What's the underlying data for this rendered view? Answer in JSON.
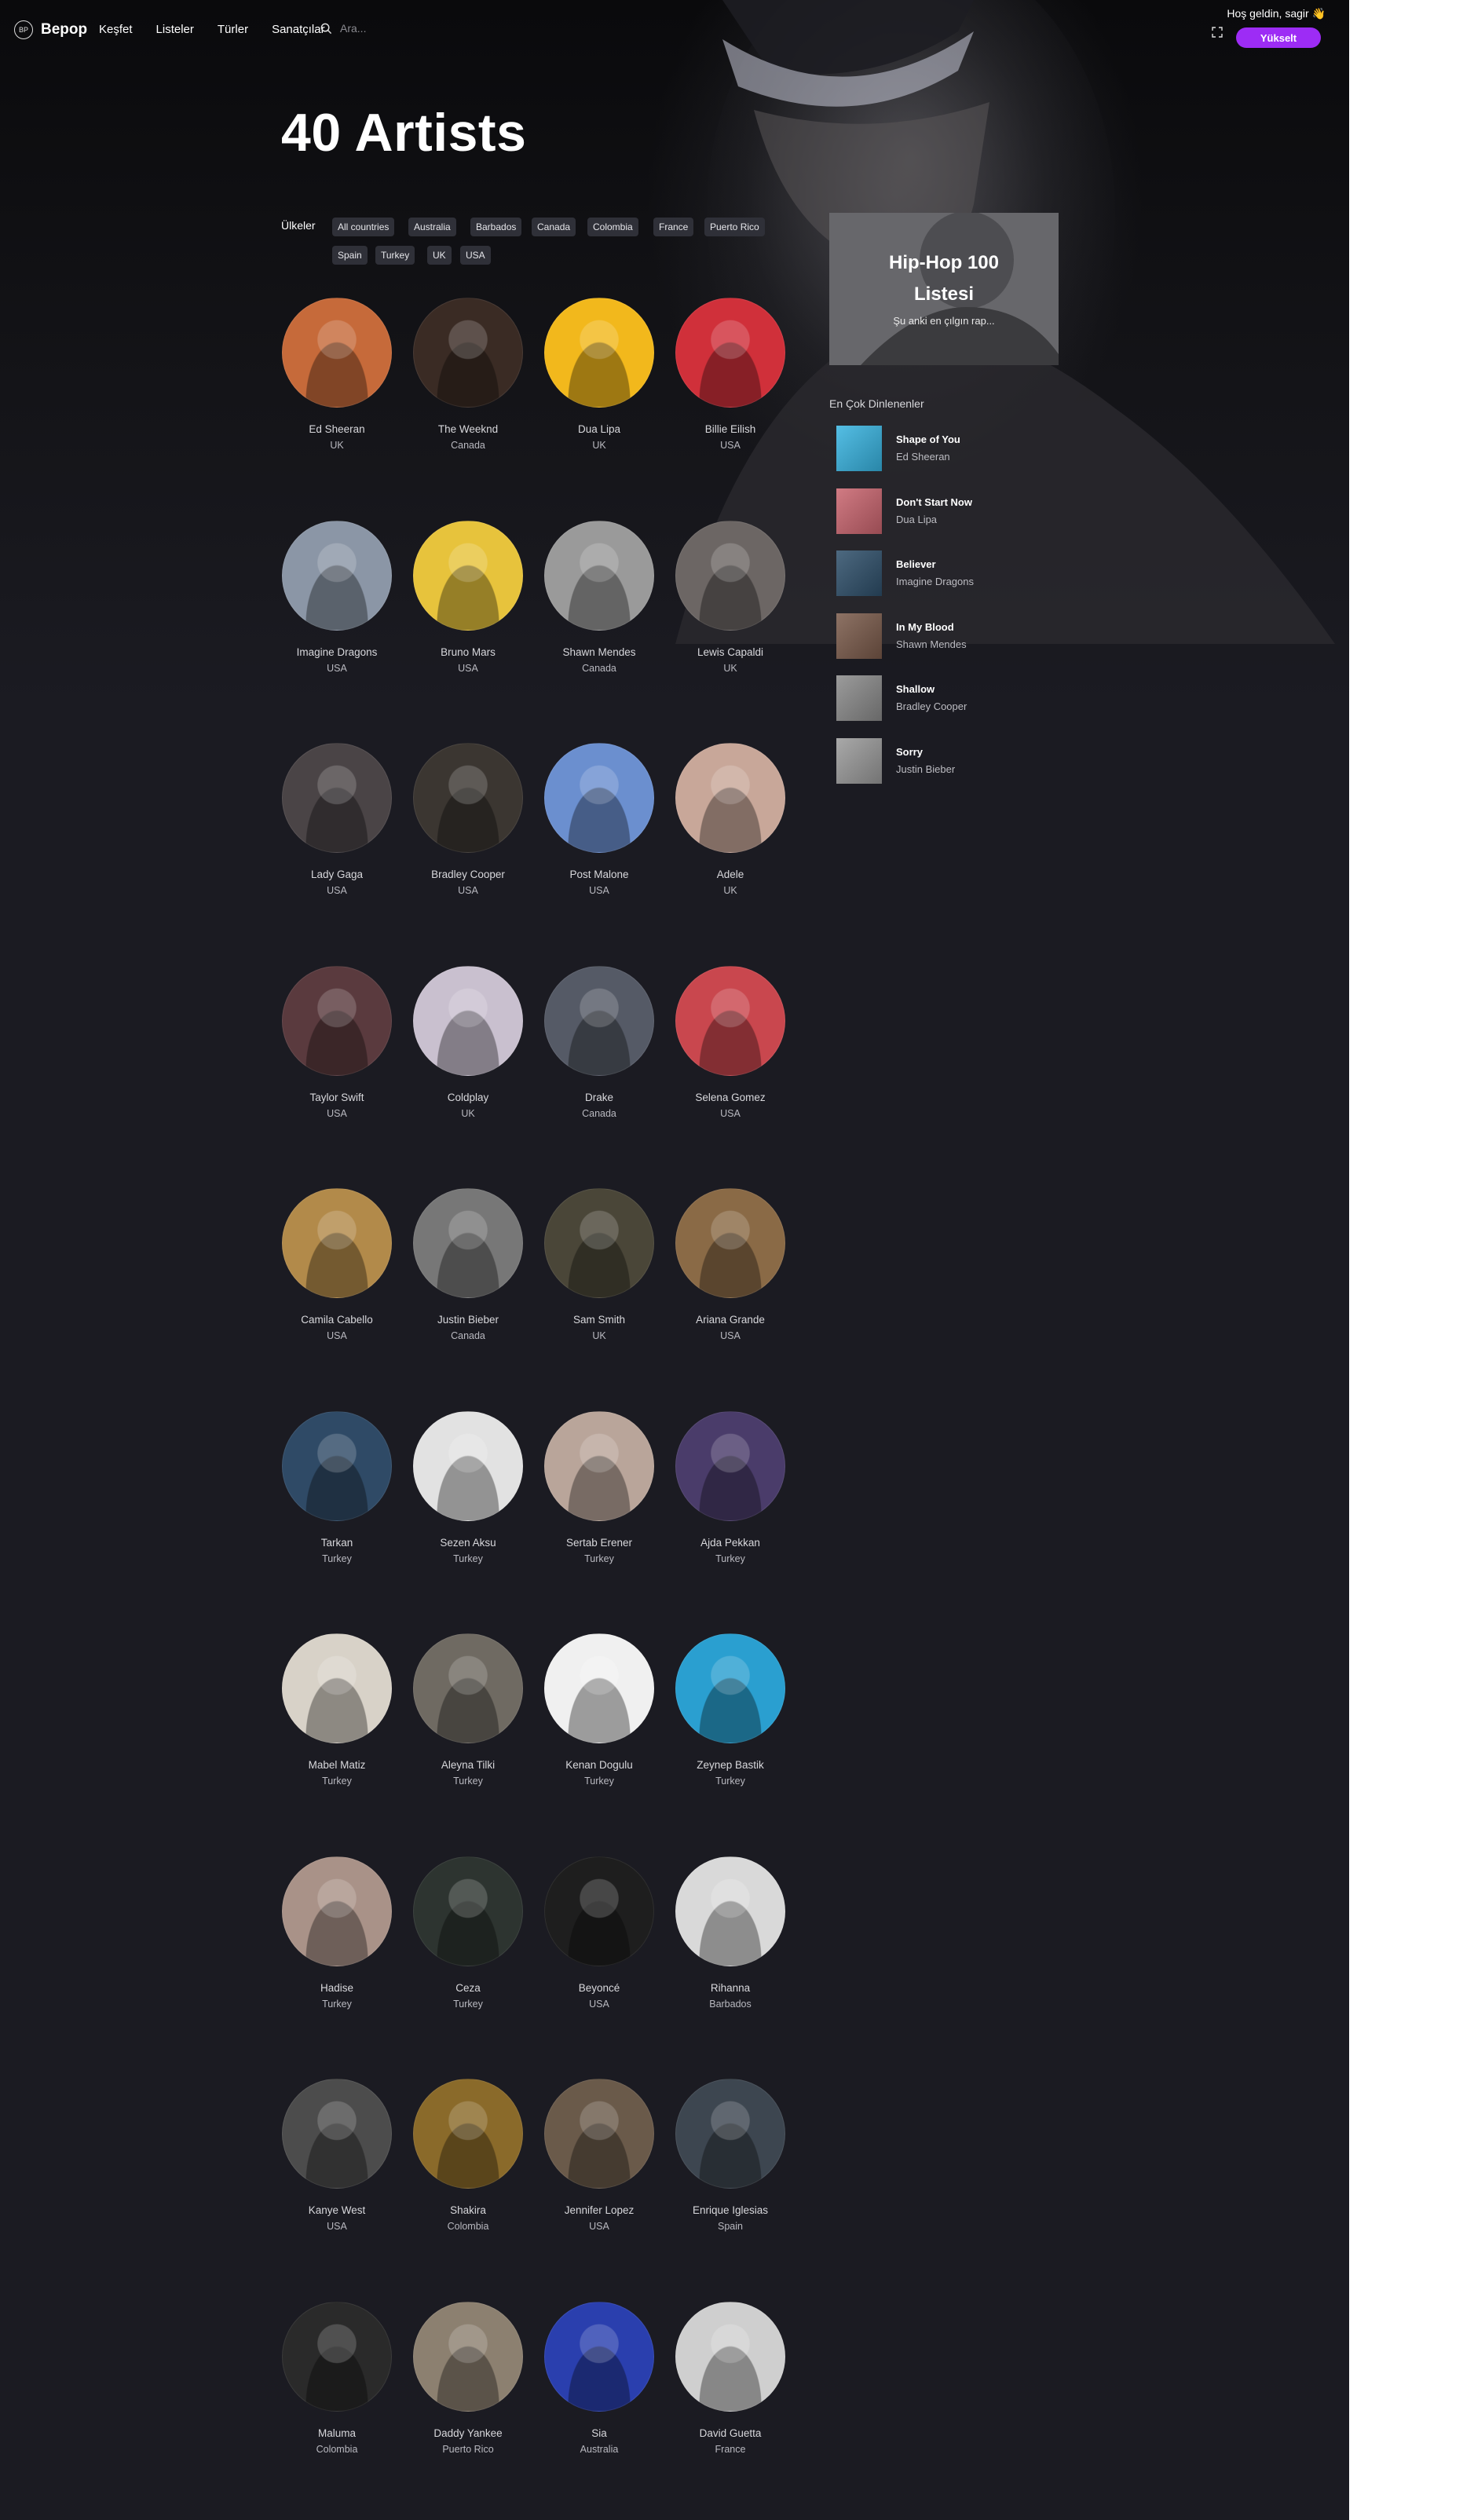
{
  "brand": {
    "logo_mark": "BP",
    "name": "Bepop"
  },
  "nav": {
    "links": [
      "Keşfet",
      "Listeler",
      "Türler",
      "Sanatçılar"
    ]
  },
  "search": {
    "placeholder": "Ara..."
  },
  "user": {
    "welcome": "Hoş geldin, sagir 👋",
    "upgrade_label": "Yükselt"
  },
  "page": {
    "title": "40 Artists"
  },
  "filters": {
    "label": "Ülkeler",
    "countries": [
      "All countries",
      "Australia",
      "Barbados",
      "Canada",
      "Colombia",
      "France",
      "Puerto Rico",
      "Spain",
      "Turkey",
      "UK",
      "USA"
    ]
  },
  "artists": [
    {
      "name": "Ed Sheeran",
      "country": "UK",
      "color": "#c66a3a"
    },
    {
      "name": "The Weeknd",
      "country": "Canada",
      "color": "#3a2b24"
    },
    {
      "name": "Dua Lipa",
      "country": "UK",
      "color": "#f2b81c"
    },
    {
      "name": "Billie Eilish",
      "country": "USA",
      "color": "#d0303a"
    },
    {
      "name": "Imagine Dragons",
      "country": "USA",
      "color": "#8b96a6"
    },
    {
      "name": "Bruno Mars",
      "country": "USA",
      "color": "#e7c33c"
    },
    {
      "name": "Shawn Mendes",
      "country": "Canada",
      "color": "#9a9a9a"
    },
    {
      "name": "Lewis Capaldi",
      "country": "UK",
      "color": "#6c6664"
    },
    {
      "name": "Lady Gaga",
      "country": "USA",
      "color": "#4a4446"
    },
    {
      "name": "Bradley Cooper",
      "country": "USA",
      "color": "#3b3631"
    },
    {
      "name": "Post Malone",
      "country": "USA",
      "color": "#6b8fcf"
    },
    {
      "name": "Adele",
      "country": "UK",
      "color": "#c8a799"
    },
    {
      "name": "Taylor Swift",
      "country": "USA",
      "color": "#5a3a3e"
    },
    {
      "name": "Coldplay",
      "country": "UK",
      "color": "#c9c0cf"
    },
    {
      "name": "Drake",
      "country": "Canada",
      "color": "#555a66"
    },
    {
      "name": "Selena Gomez",
      "country": "USA",
      "color": "#c9474e"
    },
    {
      "name": "Camila Cabello",
      "country": "USA",
      "color": "#b28a4a"
    },
    {
      "name": "Justin Bieber",
      "country": "Canada",
      "color": "#777"
    },
    {
      "name": "Sam Smith",
      "country": "UK",
      "color": "#4a4638"
    },
    {
      "name": "Ariana Grande",
      "country": "USA",
      "color": "#8a6a46"
    },
    {
      "name": "Tarkan",
      "country": "Turkey",
      "color": "#2f4a66"
    },
    {
      "name": "Sezen Aksu",
      "country": "Turkey",
      "color": "#e2e2e2"
    },
    {
      "name": "Sertab Erener",
      "country": "Turkey",
      "color": "#b9a59a"
    },
    {
      "name": "Ajda Pekkan",
      "country": "Turkey",
      "color": "#4a3c6a"
    },
    {
      "name": "Mabel Matiz",
      "country": "Turkey",
      "color": "#d8d2c8"
    },
    {
      "name": "Aleyna Tilki",
      "country": "Turkey",
      "color": "#6f6a62"
    },
    {
      "name": "Kenan Dogulu",
      "country": "Turkey",
      "color": "#f0f0f0"
    },
    {
      "name": "Zeynep Bastik",
      "country": "Turkey",
      "color": "#2a9fd0"
    },
    {
      "name": "Hadise",
      "country": "Turkey",
      "color": "#a99288"
    },
    {
      "name": "Ceza",
      "country": "Turkey",
      "color": "#2d3430"
    },
    {
      "name": "Beyoncé",
      "country": "USA",
      "color": "#1e1e1e"
    },
    {
      "name": "Rihanna",
      "country": "Barbados",
      "color": "#d9d9d9"
    },
    {
      "name": "Kanye West",
      "country": "USA",
      "color": "#4c4c4c"
    },
    {
      "name": "Shakira",
      "country": "Colombia",
      "color": "#8a6a2a"
    },
    {
      "name": "Jennifer Lopez",
      "country": "USA",
      "color": "#6a5a4a"
    },
    {
      "name": "Enrique Iglesias",
      "country": "Spain",
      "color": "#3d4650"
    },
    {
      "name": "Maluma",
      "country": "Colombia",
      "color": "#2a2a2a"
    },
    {
      "name": "Daddy Yankee",
      "country": "Puerto Rico",
      "color": "#8c8070"
    },
    {
      "name": "Sia",
      "country": "Australia",
      "color": "#2a3fae"
    },
    {
      "name": "David Guetta",
      "country": "France",
      "color": "#cfcfcf"
    }
  ],
  "promo": {
    "title_line1": "Hip-Hop 100",
    "title_line2": "Listesi",
    "subtitle": "Şu anki en çılgın rap..."
  },
  "top_tracks": {
    "heading": "En Çok Dinlenenler",
    "items": [
      {
        "title": "Shape of You",
        "artist": "Ed Sheeran",
        "color": "#37b3e0"
      },
      {
        "title": "Don't Start Now",
        "artist": "Dua Lipa",
        "color": "#c9646e"
      },
      {
        "title": "Believer",
        "artist": "Imagine Dragons",
        "color": "#2e4f6a"
      },
      {
        "title": "In My Blood",
        "artist": "Shawn Mendes",
        "color": "#7a5a4a"
      },
      {
        "title": "Shallow",
        "artist": "Bradley Cooper",
        "color": "#8a8a8a"
      },
      {
        "title": "Sorry",
        "artist": "Justin Bieber",
        "color": "#9a9a9a"
      }
    ]
  }
}
